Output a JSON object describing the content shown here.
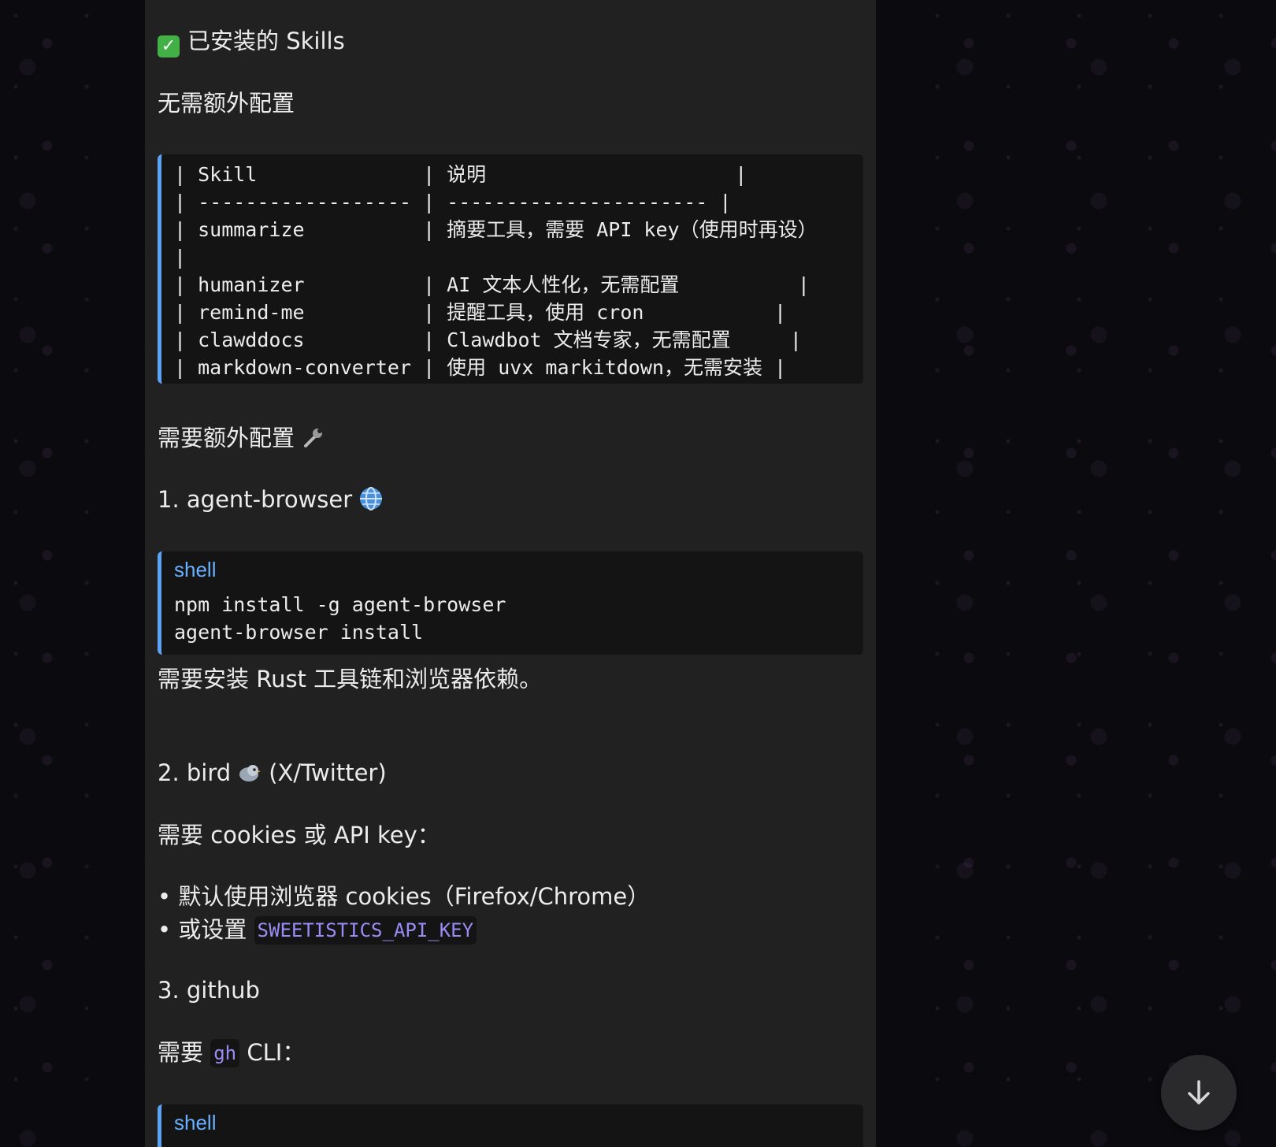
{
  "message": {
    "heading": "已安装的 Skills",
    "heading_icon": "check-mark-emoji",
    "no_config_label": "无需额外配置",
    "table_block": {
      "lines": [
        "| Skill              | 说明                     |",
        "| ------------------ | ---------------------- |",
        "| summarize          | 摘要工具，需要 API key（使用时再设）",
        "|",
        "| humanizer          | AI 文本人性化，无需配置          |",
        "| remind-me          | 提醒工具，使用 cron           |",
        "| clawddocs          | Clawdbot 文档专家，无需配置     |",
        "| markdown-converter | 使用 uvx markitdown，无需安装 |"
      ]
    },
    "needs_config_label": "需要额外配置",
    "needs_config_icon": "wrench-icon",
    "item1": {
      "title": "1. agent-browser",
      "icon": "globe-icon",
      "code_lang": "shell",
      "code_lines": [
        "npm install -g agent-browser",
        "agent-browser install"
      ],
      "note": "需要安装 Rust 工具链和浏览器依赖。"
    },
    "item2": {
      "title_prefix": "2. bird",
      "icon": "bird-icon",
      "title_suffix": "(X/Twitter)",
      "requirement": "需要 cookies 或 API key：",
      "bullet1": "• 默认使用浏览器 cookies（Firefox/Chrome）",
      "bullet2_prefix": "• 或设置",
      "bullet2_code": "SWEETISTICS_API_KEY"
    },
    "item3": {
      "title": "3. github",
      "requirement_prefix": "需要",
      "requirement_code": "gh",
      "requirement_suffix": "CLI：",
      "code_lang": "shell"
    }
  },
  "colors": {
    "bubble_bg": "#212121",
    "code_bg": "#141414",
    "code_border": "#5ba4f5",
    "inline_code_text": "#9a8cf5",
    "lang_label": "#6ab0ff"
  }
}
